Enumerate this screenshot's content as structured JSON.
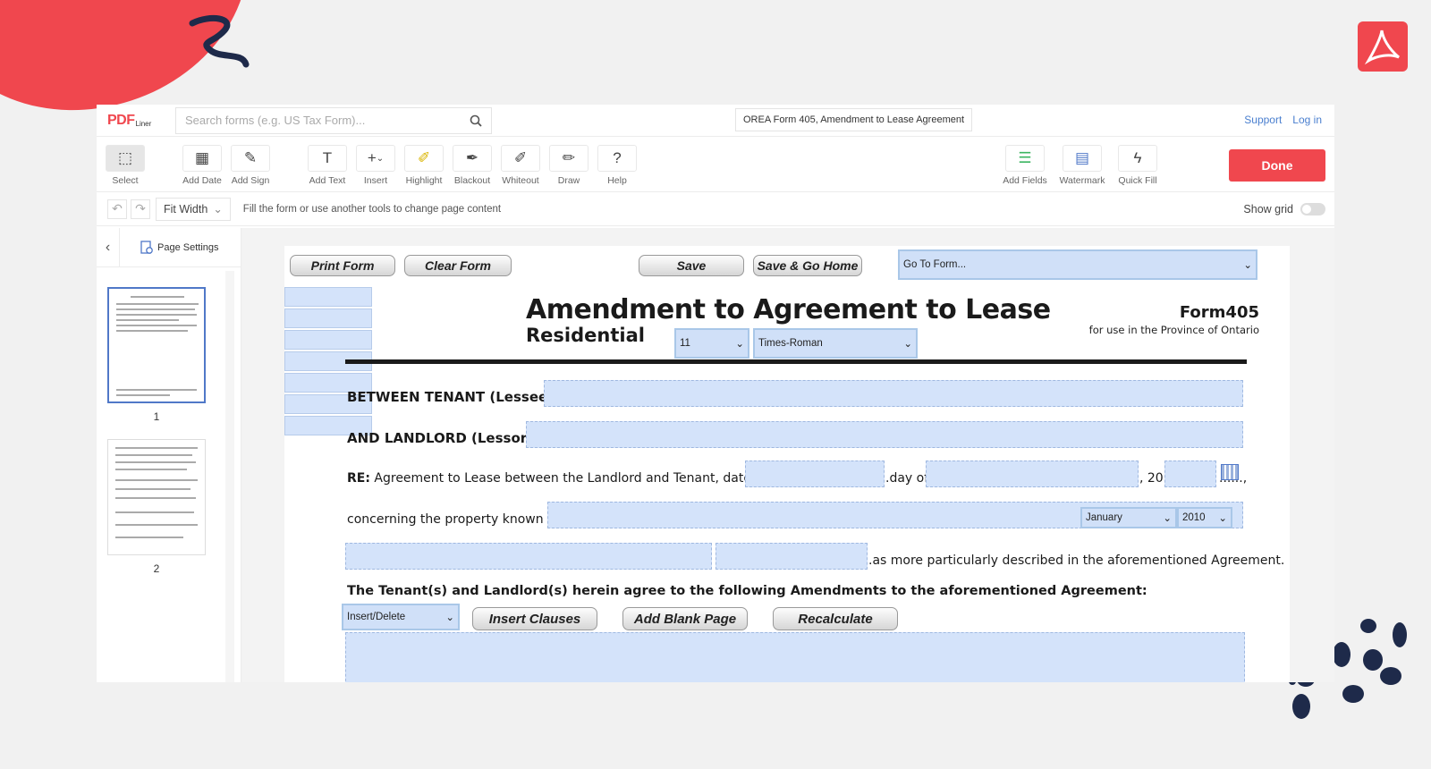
{
  "app": {
    "logo_main": "PDF",
    "logo_sub": "Liner",
    "search_placeholder": "Search forms (e.g. US Tax Form)...",
    "doc_title": "OREA Form 405, Amendment to Lease Agreement",
    "support": "Support",
    "login": "Log in"
  },
  "toolbar": {
    "select": "Select",
    "add_date": "Add Date",
    "add_sign": "Add Sign",
    "add_text": "Add Text",
    "insert": "Insert",
    "highlight": "Highlight",
    "blackout": "Blackout",
    "whiteout": "Whiteout",
    "draw": "Draw",
    "help": "Help",
    "add_fields": "Add Fields",
    "watermark": "Watermark",
    "quick_fill": "Quick Fill",
    "done": "Done"
  },
  "subbar": {
    "zoom": "Fit Width",
    "hint": "Fill the form or use another tools to change page content",
    "show_grid": "Show grid"
  },
  "sidebar": {
    "page_settings": "Page Settings",
    "pages": [
      "1",
      "2"
    ]
  },
  "document": {
    "buttons": {
      "print": "Print Form",
      "clear": "Clear Form",
      "save": "Save",
      "save_home": "Save & Go Home",
      "insert_clauses": "Insert Clauses",
      "add_blank_page": "Add Blank Page",
      "recalculate": "Recalculate"
    },
    "selects": {
      "goto_form": "Go To Form...",
      "font_size": "11",
      "font_family": "Times-Roman",
      "month": "January",
      "year": "2010",
      "insert_delete": "Insert/Delete"
    },
    "title": "Amendment to Agreement to Lease",
    "subtitle": "Residential",
    "form_label": "Form",
    "form_number": "405",
    "form_desc": "for use in the Province of Ontario",
    "between_label": "BETWEEN TENANT (Lessee),",
    "landlord_label": "AND LANDLORD (Lessor),",
    "re_label": "RE:",
    "re_text": "Agreement to Lease between the Landlord and Tenant, dated the",
    "day_of": ".day of",
    "year_prefix": ", 20",
    "year_suffix": "......,",
    "property_text": "concerning the property known as",
    "described_text": ".as more particularly described in the aforementioned Agreement.",
    "agree_text": "The Tenant(s) and Landlord(s) herein agree to the following Amendments to the aforementioned Agreement:"
  },
  "colors": {
    "brand_red": "#f0474e",
    "field_blue": "#d4e3fa",
    "link_blue": "#4a7fcf"
  }
}
